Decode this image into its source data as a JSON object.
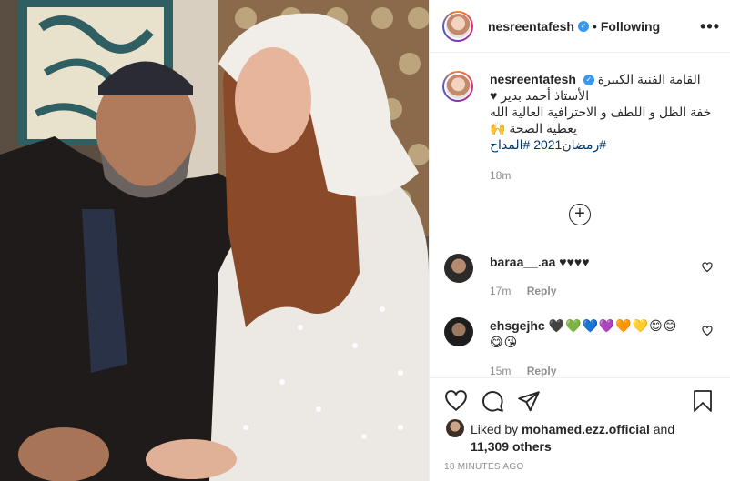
{
  "post": {
    "username": "nesreentafesh",
    "dot": "•",
    "follow_status": "Following",
    "more": "•••"
  },
  "caption": {
    "username": "nesreentafesh",
    "line1": "القامة الفنية الكبيرة",
    "line2": "الأستاذ أحمد بدير ♥",
    "line3": "خفة الظل و اللطف و الاحترافية العالية الله",
    "line4": "يعطيه الصحة 🙌",
    "hashtags": "#رمضان2021 #المداح",
    "time": "18m"
  },
  "load_more": "+",
  "comments": [
    {
      "username": "baraa__.aa",
      "text": "♥♥♥♥",
      "time": "17m",
      "reply": "Reply"
    },
    {
      "username": "ehsgejhc",
      "text": "🖤💚💙💜🧡💛😊😊",
      "text2": "😋😘",
      "time": "15m",
      "reply": "Reply"
    }
  ],
  "likes": {
    "prefix": "Liked by",
    "user": "mohamed.ezz.official",
    "and": "and",
    "count": "11,309 others"
  },
  "timestamp": "18 MINUTES AGO"
}
